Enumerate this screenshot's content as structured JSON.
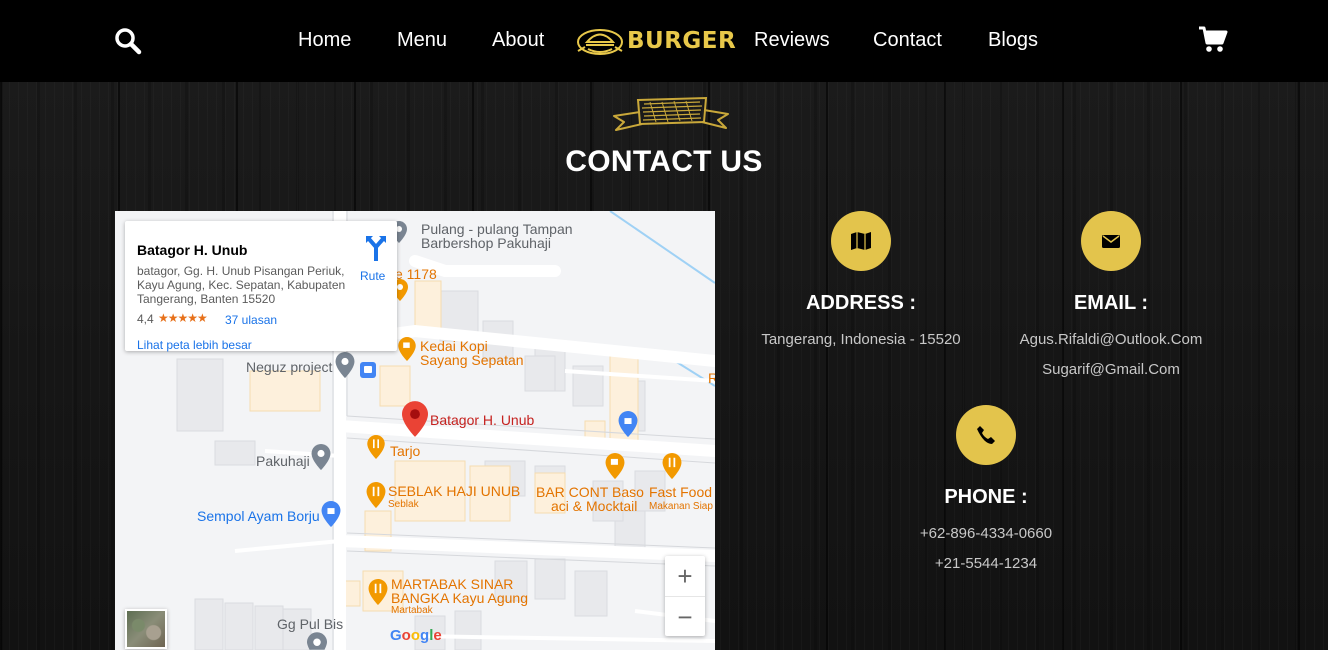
{
  "nav": {
    "items": [
      "Home",
      "Menu",
      "About",
      "Reviews",
      "Contact",
      "Blogs"
    ],
    "logo_text": "BURGER",
    "search_icon": "search-icon",
    "cart_icon": "cart-icon"
  },
  "section": {
    "title": "CONTACT US"
  },
  "map": {
    "place_title": "Batagor H. Unub",
    "place_address": "batagor, Gg. H. Unub Pisangan Periuk, Kayu Agung, Kec. Sepatan, Kabupaten Tangerang, Banten 15520",
    "rating": "4,4",
    "stars": "★★★★★",
    "reviews": "37 ulasan",
    "route_label": "Rute",
    "larger_map": "Lihat peta lebih besar",
    "zoom_in": "+",
    "zoom_out": "−",
    "labels": {
      "pulang": "Pulang - pulang Tampan",
      "barbershop": "Barbershop Pakuhaji",
      "e1178": "e 1178",
      "kedai1": "Kedai Kopi",
      "kedai2": "Sayang Sepatan",
      "neguz": "Neguz project",
      "batagor": "Batagor H. Unub",
      "tarjo": "Tarjo",
      "pakuhaji": "Pakuhaji",
      "seblak": "SEBLAK HAJI UNUB",
      "seblak_sub": "Seblak",
      "barcont1": "BAR CONT Baso",
      "barcont2": "aci & Mocktail",
      "fastfood": "Fast Food",
      "fastfood_sub": "Makanan Siap",
      "sempol": "Sempol Ayam Borju",
      "martabak1": "MARTABAK SINAR",
      "martabak2": "BANGKA Kayu Agung",
      "martabak_sub": "Martabak",
      "gg_pul": "Gg Pul Bis",
      "edge_r": "R"
    },
    "google": [
      "G",
      "o",
      "o",
      "g",
      "l",
      "e"
    ],
    "colors": {
      "pin_red": "#ea4335",
      "poi_orange": "#f29900",
      "poi_gray": "#7a8592",
      "poi_blue": "#4285f4"
    }
  },
  "contact": {
    "address_head": "ADDRESS :",
    "address": "Tangerang, Indonesia - 15520",
    "email_head": "EMAIL :",
    "email_1": "Agus.Rifaldi@Outlook.Com",
    "email_2": "Sugarif@Gmail.Com",
    "phone_head": "PHONE :",
    "phone_1": "+62-896-4334-0660",
    "phone_2": "+21-5544-1234",
    "accent": "#e3c44c"
  }
}
